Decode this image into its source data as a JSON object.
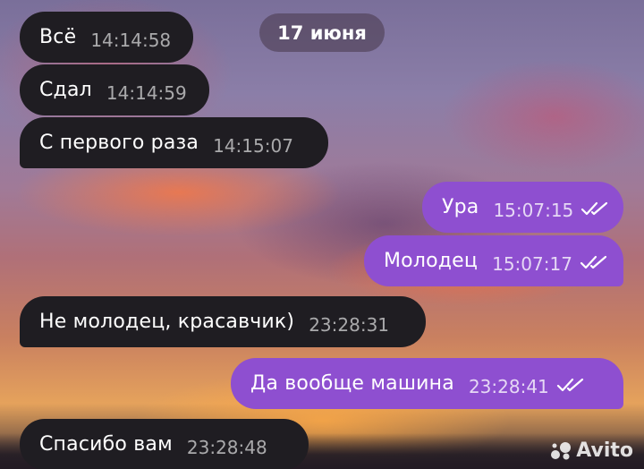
{
  "chat": {
    "date_separator": "17 июня",
    "messages": [
      {
        "text": "Всё",
        "time": "14:14:58",
        "direction": "incoming"
      },
      {
        "text": "Сдал",
        "time": "14:14:59",
        "direction": "incoming"
      },
      {
        "text": "С первого раза",
        "time": "14:15:07",
        "direction": "incoming"
      },
      {
        "text": "Ура",
        "time": "15:07:15",
        "direction": "outgoing",
        "status": "read"
      },
      {
        "text": "Молодец",
        "time": "15:07:17",
        "direction": "outgoing",
        "status": "read"
      },
      {
        "text": "Не молодец, красавчик)",
        "time": "23:28:31",
        "direction": "incoming"
      },
      {
        "text": "Да вообще машина",
        "time": "23:28:41",
        "direction": "outgoing",
        "status": "read"
      },
      {
        "text": "Спасибо вам",
        "time": "23:28:48",
        "direction": "incoming"
      }
    ]
  },
  "watermark": {
    "text": "Avito"
  },
  "colors": {
    "incoming_bubble": "#1f1d22",
    "outgoing_bubble": "#8e4fd0",
    "date_pill": "#4b3c50"
  },
  "icons": {
    "read_status": "double-check-icon",
    "watermark": "avito-logo"
  }
}
